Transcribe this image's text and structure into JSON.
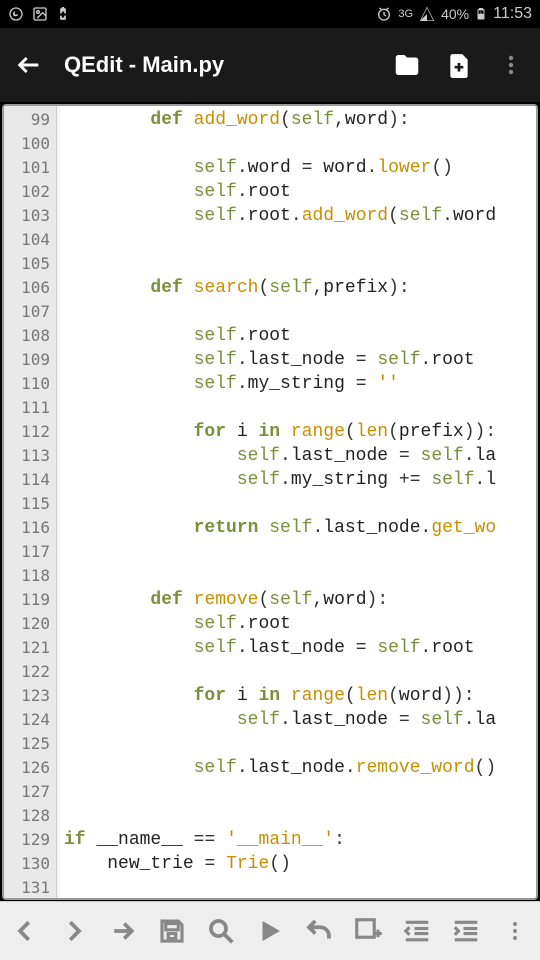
{
  "status": {
    "network": "3G",
    "battery": "40%",
    "time": "11:53"
  },
  "app": {
    "title": "QEdit - Main.py"
  },
  "code": {
    "lines": [
      {
        "n": "99",
        "t": [
          [
            "sp",
            "        "
          ],
          [
            "kw",
            "def"
          ],
          [
            "sp",
            " "
          ],
          [
            "fn",
            "add_word"
          ],
          [
            "op",
            "("
          ],
          [
            "self",
            "self"
          ],
          [
            "op",
            ","
          ],
          [
            "id",
            "word"
          ],
          [
            "op",
            "):"
          ]
        ]
      },
      {
        "n": "100",
        "t": []
      },
      {
        "n": "101",
        "t": [
          [
            "sp",
            "            "
          ],
          [
            "self",
            "self"
          ],
          [
            "op",
            "."
          ],
          [
            "id",
            "word "
          ],
          [
            "op",
            "="
          ],
          [
            "id",
            " word"
          ],
          [
            "op",
            "."
          ],
          [
            "fn",
            "lower"
          ],
          [
            "op",
            "()"
          ]
        ]
      },
      {
        "n": "102",
        "t": [
          [
            "sp",
            "            "
          ],
          [
            "self",
            "self"
          ],
          [
            "op",
            "."
          ],
          [
            "id",
            "root"
          ]
        ]
      },
      {
        "n": "103",
        "t": [
          [
            "sp",
            "            "
          ],
          [
            "self",
            "self"
          ],
          [
            "op",
            "."
          ],
          [
            "id",
            "root"
          ],
          [
            "op",
            "."
          ],
          [
            "fn",
            "add_word"
          ],
          [
            "op",
            "("
          ],
          [
            "self",
            "self"
          ],
          [
            "op",
            "."
          ],
          [
            "id",
            "word"
          ]
        ]
      },
      {
        "n": "104",
        "t": []
      },
      {
        "n": "105",
        "t": []
      },
      {
        "n": "106",
        "t": [
          [
            "sp",
            "        "
          ],
          [
            "kw",
            "def"
          ],
          [
            "sp",
            " "
          ],
          [
            "fn",
            "search"
          ],
          [
            "op",
            "("
          ],
          [
            "self",
            "self"
          ],
          [
            "op",
            ","
          ],
          [
            "id",
            "prefix"
          ],
          [
            "op",
            "):"
          ]
        ]
      },
      {
        "n": "107",
        "t": []
      },
      {
        "n": "108",
        "t": [
          [
            "sp",
            "            "
          ],
          [
            "self",
            "self"
          ],
          [
            "op",
            "."
          ],
          [
            "id",
            "root"
          ]
        ]
      },
      {
        "n": "109",
        "t": [
          [
            "sp",
            "            "
          ],
          [
            "self",
            "self"
          ],
          [
            "op",
            "."
          ],
          [
            "id",
            "last_node "
          ],
          [
            "op",
            "="
          ],
          [
            "sp",
            " "
          ],
          [
            "self",
            "self"
          ],
          [
            "op",
            "."
          ],
          [
            "id",
            "root"
          ]
        ]
      },
      {
        "n": "110",
        "t": [
          [
            "sp",
            "            "
          ],
          [
            "self",
            "self"
          ],
          [
            "op",
            "."
          ],
          [
            "id",
            "my_string "
          ],
          [
            "op",
            "="
          ],
          [
            "sp",
            " "
          ],
          [
            "str",
            "''"
          ]
        ]
      },
      {
        "n": "111",
        "t": []
      },
      {
        "n": "112",
        "t": [
          [
            "sp",
            "            "
          ],
          [
            "kw",
            "for"
          ],
          [
            "sp",
            " "
          ],
          [
            "id",
            "i "
          ],
          [
            "kw",
            "in"
          ],
          [
            "sp",
            " "
          ],
          [
            "bn",
            "range"
          ],
          [
            "op",
            "("
          ],
          [
            "bn",
            "len"
          ],
          [
            "op",
            "("
          ],
          [
            "id",
            "prefix"
          ],
          [
            "op",
            ")):"
          ]
        ]
      },
      {
        "n": "113",
        "t": [
          [
            "sp",
            "                "
          ],
          [
            "self",
            "self"
          ],
          [
            "op",
            "."
          ],
          [
            "id",
            "last_node "
          ],
          [
            "op",
            "="
          ],
          [
            "sp",
            " "
          ],
          [
            "self",
            "self"
          ],
          [
            "op",
            "."
          ],
          [
            "id",
            "la"
          ]
        ]
      },
      {
        "n": "114",
        "t": [
          [
            "sp",
            "                "
          ],
          [
            "self",
            "self"
          ],
          [
            "op",
            "."
          ],
          [
            "id",
            "my_string "
          ],
          [
            "op",
            "+="
          ],
          [
            "sp",
            " "
          ],
          [
            "self",
            "self"
          ],
          [
            "op",
            "."
          ],
          [
            "id",
            "l"
          ]
        ]
      },
      {
        "n": "115",
        "t": []
      },
      {
        "n": "116",
        "t": [
          [
            "sp",
            "            "
          ],
          [
            "kw",
            "return"
          ],
          [
            "sp",
            " "
          ],
          [
            "self",
            "self"
          ],
          [
            "op",
            "."
          ],
          [
            "id",
            "last_node"
          ],
          [
            "op",
            "."
          ],
          [
            "fn",
            "get_wo"
          ]
        ]
      },
      {
        "n": "117",
        "t": []
      },
      {
        "n": "118",
        "t": []
      },
      {
        "n": "119",
        "t": [
          [
            "sp",
            "        "
          ],
          [
            "kw",
            "def"
          ],
          [
            "sp",
            " "
          ],
          [
            "fn",
            "remove"
          ],
          [
            "op",
            "("
          ],
          [
            "self",
            "self"
          ],
          [
            "op",
            ","
          ],
          [
            "id",
            "word"
          ],
          [
            "op",
            "):"
          ]
        ]
      },
      {
        "n": "120",
        "t": [
          [
            "sp",
            "            "
          ],
          [
            "self",
            "self"
          ],
          [
            "op",
            "."
          ],
          [
            "id",
            "root"
          ]
        ]
      },
      {
        "n": "121",
        "t": [
          [
            "sp",
            "            "
          ],
          [
            "self",
            "self"
          ],
          [
            "op",
            "."
          ],
          [
            "id",
            "last_node "
          ],
          [
            "op",
            "="
          ],
          [
            "sp",
            " "
          ],
          [
            "self",
            "self"
          ],
          [
            "op",
            "."
          ],
          [
            "id",
            "root"
          ]
        ]
      },
      {
        "n": "122",
        "t": []
      },
      {
        "n": "123",
        "t": [
          [
            "sp",
            "            "
          ],
          [
            "kw",
            "for"
          ],
          [
            "sp",
            " "
          ],
          [
            "id",
            "i "
          ],
          [
            "kw",
            "in"
          ],
          [
            "sp",
            " "
          ],
          [
            "bn",
            "range"
          ],
          [
            "op",
            "("
          ],
          [
            "bn",
            "len"
          ],
          [
            "op",
            "("
          ],
          [
            "id",
            "word"
          ],
          [
            "op",
            ")):"
          ]
        ]
      },
      {
        "n": "124",
        "t": [
          [
            "sp",
            "                "
          ],
          [
            "self",
            "self"
          ],
          [
            "op",
            "."
          ],
          [
            "id",
            "last_node "
          ],
          [
            "op",
            "="
          ],
          [
            "sp",
            " "
          ],
          [
            "self",
            "self"
          ],
          [
            "op",
            "."
          ],
          [
            "id",
            "la"
          ]
        ]
      },
      {
        "n": "125",
        "t": []
      },
      {
        "n": "126",
        "t": [
          [
            "sp",
            "            "
          ],
          [
            "self",
            "self"
          ],
          [
            "op",
            "."
          ],
          [
            "id",
            "last_node"
          ],
          [
            "op",
            "."
          ],
          [
            "fn",
            "remove_word"
          ],
          [
            "op",
            "()"
          ]
        ]
      },
      {
        "n": "127",
        "t": []
      },
      {
        "n": "128",
        "t": []
      },
      {
        "n": "129",
        "t": [
          [
            "kw",
            "if"
          ],
          [
            "sp",
            " "
          ],
          [
            "id",
            "__name__ "
          ],
          [
            "op",
            "=="
          ],
          [
            "sp",
            " "
          ],
          [
            "str",
            "'__main__'"
          ],
          [
            "op",
            ":"
          ]
        ]
      },
      {
        "n": "130",
        "t": [
          [
            "sp",
            "    "
          ],
          [
            "id",
            "new_trie "
          ],
          [
            "op",
            "="
          ],
          [
            "sp",
            " "
          ],
          [
            "fn",
            "Trie"
          ],
          [
            "op",
            "()"
          ]
        ]
      },
      {
        "n": "131",
        "t": [
          [
            "sp",
            "    "
          ],
          [
            "id",
            ""
          ]
        ]
      }
    ]
  }
}
